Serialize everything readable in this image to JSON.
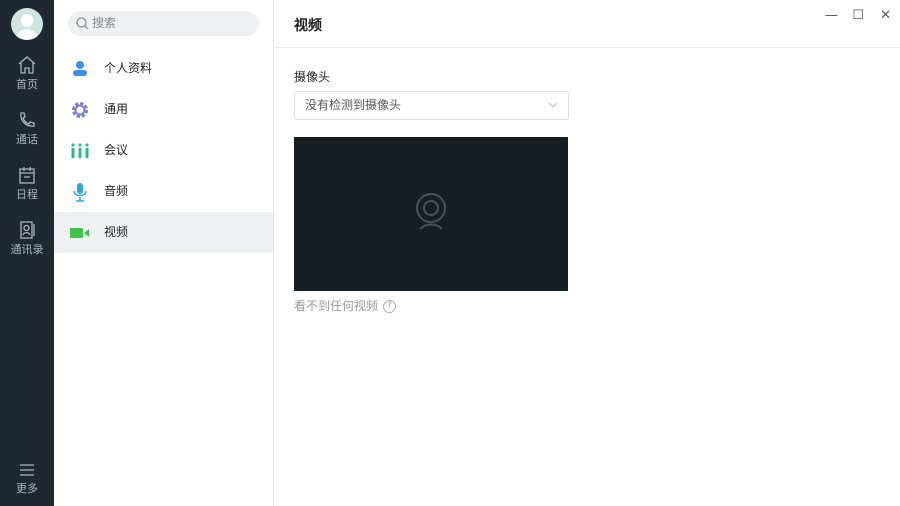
{
  "nav": {
    "items": [
      {
        "label": "首页"
      },
      {
        "label": "通话"
      },
      {
        "label": "日程"
      },
      {
        "label": "通讯录"
      }
    ],
    "more": "更多"
  },
  "settings": {
    "search_placeholder": "搜索",
    "items": [
      {
        "label": "个人资料",
        "color": "#3d8fe8"
      },
      {
        "label": "通用",
        "color": "#7a7fd8"
      },
      {
        "label": "会议",
        "color": "#2bb59b"
      },
      {
        "label": "音频",
        "color": "#2ba8e0"
      },
      {
        "label": "视频",
        "color": "#3fc14d"
      }
    ],
    "active": "视频"
  },
  "main": {
    "title": "视频",
    "camera_label": "摄像头",
    "camera_value": "没有检测到摄像头",
    "hint": "看不到任何视频",
    "help": "?"
  },
  "window": {
    "minimize": "—",
    "maximize": "☐",
    "close": "✕"
  }
}
